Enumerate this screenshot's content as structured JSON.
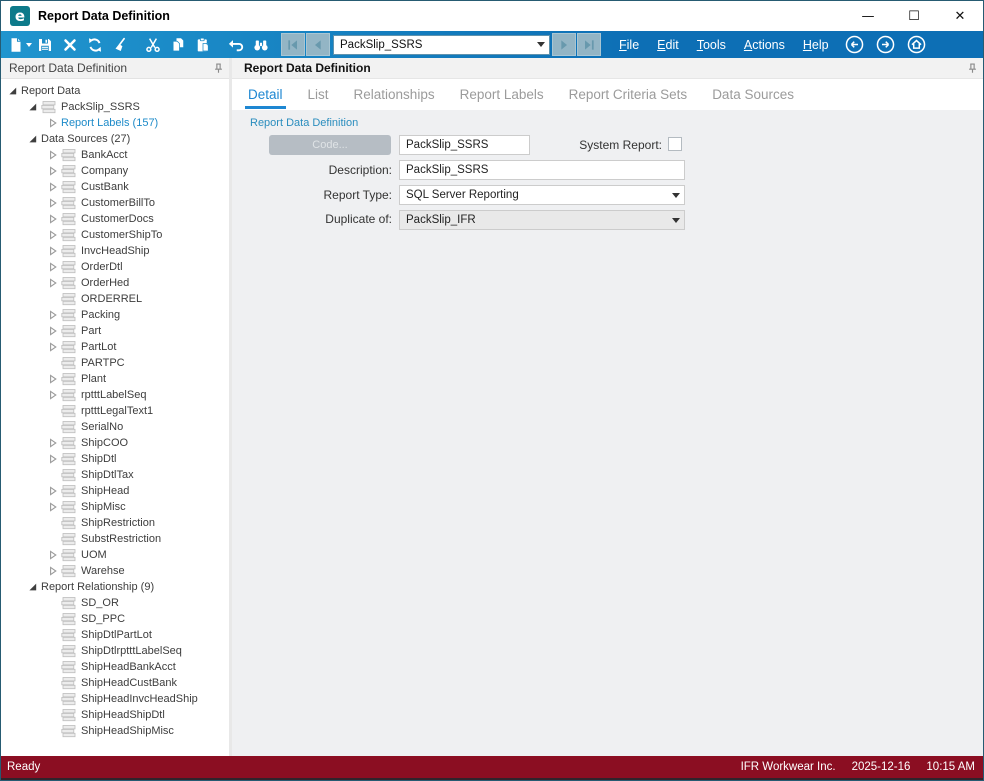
{
  "colors": {
    "toolbar_left": "#2095ce",
    "toolbar_right": "#0d6fb5",
    "accent_blue": "#1e87d2",
    "link_blue": "#1e8bc9",
    "status_maroon": "#8b0e22",
    "logo_teal": "#0d7a8a"
  },
  "window": {
    "title": "Report Data Definition",
    "logo_glyph": "e",
    "minimize": "—",
    "maximize": "☐",
    "close": "✕"
  },
  "toolbar": {
    "icons": [
      "new-icon",
      "save-icon",
      "delete-icon",
      "refresh-icon",
      "clear-icon",
      "cut-icon",
      "copy-icon",
      "paste-icon",
      "undo-icon",
      "search-icon"
    ],
    "record_combo_value": "PackSlip_SSRS",
    "menus": [
      {
        "accel": "F",
        "rest": "ile"
      },
      {
        "accel": "E",
        "rest": "dit"
      },
      {
        "accel": "T",
        "rest": "ools"
      },
      {
        "accel": "A",
        "rest": "ctions"
      },
      {
        "accel": "H",
        "rest": "elp"
      }
    ]
  },
  "tree": {
    "header": "Report Data Definition",
    "nodes": [
      {
        "label": "Report Data",
        "level": 0,
        "expand": "open",
        "icon": false,
        "blue": false
      },
      {
        "label": "PackSlip_SSRS",
        "level": 1,
        "expand": "open",
        "icon": true,
        "blue": false
      },
      {
        "label": "Report Labels (157)",
        "level": 2,
        "expand": "closed",
        "icon": false,
        "blue": true
      },
      {
        "label": "Data Sources (27)",
        "level": 1,
        "expand": "open",
        "icon": false,
        "blue": false
      },
      {
        "label": "BankAcct",
        "level": 2,
        "expand": "closed",
        "icon": true,
        "blue": false
      },
      {
        "label": "Company",
        "level": 2,
        "expand": "closed",
        "icon": true,
        "blue": false
      },
      {
        "label": "CustBank",
        "level": 2,
        "expand": "closed",
        "icon": true,
        "blue": false
      },
      {
        "label": "CustomerBillTo",
        "level": 2,
        "expand": "closed",
        "icon": true,
        "blue": false
      },
      {
        "label": "CustomerDocs",
        "level": 2,
        "expand": "closed",
        "icon": true,
        "blue": false
      },
      {
        "label": "CustomerShipTo",
        "level": 2,
        "expand": "closed",
        "icon": true,
        "blue": false
      },
      {
        "label": "InvcHeadShip",
        "level": 2,
        "expand": "closed",
        "icon": true,
        "blue": false
      },
      {
        "label": "OrderDtl",
        "level": 2,
        "expand": "closed",
        "icon": true,
        "blue": false
      },
      {
        "label": "OrderHed",
        "level": 2,
        "expand": "closed",
        "icon": true,
        "blue": false
      },
      {
        "label": "ORDERREL",
        "level": 2,
        "expand": "leaf",
        "icon": true,
        "blue": false
      },
      {
        "label": "Packing",
        "level": 2,
        "expand": "closed",
        "icon": true,
        "blue": false
      },
      {
        "label": "Part",
        "level": 2,
        "expand": "closed",
        "icon": true,
        "blue": false
      },
      {
        "label": "PartLot",
        "level": 2,
        "expand": "closed",
        "icon": true,
        "blue": false
      },
      {
        "label": "PARTPC",
        "level": 2,
        "expand": "leaf",
        "icon": true,
        "blue": false
      },
      {
        "label": "Plant",
        "level": 2,
        "expand": "closed",
        "icon": true,
        "blue": false
      },
      {
        "label": "rptttLabelSeq",
        "level": 2,
        "expand": "closed",
        "icon": true,
        "blue": false
      },
      {
        "label": "rptttLegalText1",
        "level": 2,
        "expand": "leaf",
        "icon": true,
        "blue": false
      },
      {
        "label": "SerialNo",
        "level": 2,
        "expand": "leaf",
        "icon": true,
        "blue": false
      },
      {
        "label": "ShipCOO",
        "level": 2,
        "expand": "closed",
        "icon": true,
        "blue": false
      },
      {
        "label": "ShipDtl",
        "level": 2,
        "expand": "closed",
        "icon": true,
        "blue": false
      },
      {
        "label": "ShipDtlTax",
        "level": 2,
        "expand": "leaf",
        "icon": true,
        "blue": false
      },
      {
        "label": "ShipHead",
        "level": 2,
        "expand": "closed",
        "icon": true,
        "blue": false
      },
      {
        "label": "ShipMisc",
        "level": 2,
        "expand": "closed",
        "icon": true,
        "blue": false
      },
      {
        "label": "ShipRestriction",
        "level": 2,
        "expand": "leaf",
        "icon": true,
        "blue": false
      },
      {
        "label": "SubstRestriction",
        "level": 2,
        "expand": "leaf",
        "icon": true,
        "blue": false
      },
      {
        "label": "UOM",
        "level": 2,
        "expand": "closed",
        "icon": true,
        "blue": false
      },
      {
        "label": "Warehse",
        "level": 2,
        "expand": "closed",
        "icon": true,
        "blue": false
      },
      {
        "label": "Report Relationship (9)",
        "level": 1,
        "expand": "open",
        "icon": false,
        "blue": false
      },
      {
        "label": "SD_OR",
        "level": 2,
        "expand": "leaf",
        "icon": true,
        "blue": false
      },
      {
        "label": "SD_PPC",
        "level": 2,
        "expand": "leaf",
        "icon": true,
        "blue": false
      },
      {
        "label": "ShipDtlPartLot",
        "level": 2,
        "expand": "leaf",
        "icon": true,
        "blue": false
      },
      {
        "label": "ShipDtlrptttLabelSeq",
        "level": 2,
        "expand": "leaf",
        "icon": true,
        "blue": false
      },
      {
        "label": "ShipHeadBankAcct",
        "level": 2,
        "expand": "leaf",
        "icon": true,
        "blue": false
      },
      {
        "label": "ShipHeadCustBank",
        "level": 2,
        "expand": "leaf",
        "icon": true,
        "blue": false
      },
      {
        "label": "ShipHeadInvcHeadShip",
        "level": 2,
        "expand": "leaf",
        "icon": true,
        "blue": false
      },
      {
        "label": "ShipHeadShipDtl",
        "level": 2,
        "expand": "leaf",
        "icon": true,
        "blue": false
      },
      {
        "label": "ShipHeadShipMisc",
        "level": 2,
        "expand": "leaf",
        "icon": true,
        "blue": false
      }
    ]
  },
  "main": {
    "header": "Report Data Definition",
    "tabs": [
      {
        "label": "Detail",
        "active": true
      },
      {
        "label": "List",
        "active": false
      },
      {
        "label": "Relationships",
        "active": false
      },
      {
        "label": "Report Labels",
        "active": false
      },
      {
        "label": "Report Criteria Sets",
        "active": false
      },
      {
        "label": "Data Sources",
        "active": false
      }
    ],
    "group_label": "Report Data Definition",
    "form": {
      "code_button_label": "Code...",
      "code_value": "PackSlip_SSRS",
      "system_report_label": "System Report:",
      "system_report_checked": false,
      "description_label": "Description:",
      "description_value": "PackSlip_SSRS",
      "report_type_label": "Report Type:",
      "report_type_value": "SQL Server Reporting",
      "duplicate_of_label": "Duplicate of:",
      "duplicate_of_value": "PackSlip_IFR"
    }
  },
  "statusbar": {
    "left": "Ready",
    "company": "IFR Workwear Inc.",
    "date": "2025-12-16",
    "time": "10:15 AM"
  }
}
